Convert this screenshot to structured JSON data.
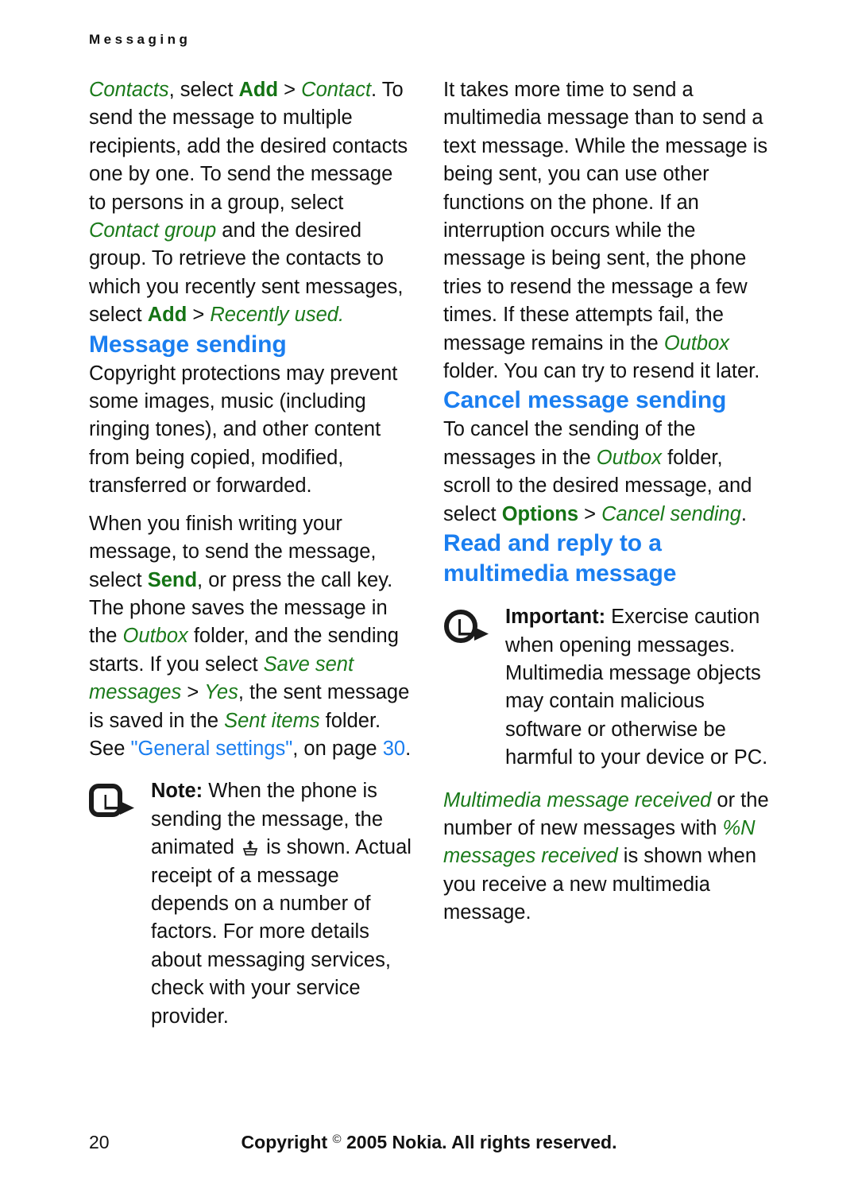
{
  "document": {
    "running_head": "Messaging",
    "page_number": "20",
    "footer_copyright_prefix": "Copyright",
    "footer_copyright_symbol": "©",
    "footer_copyright_suffix": "2005 Nokia. All rights reserved."
  },
  "colors": {
    "heading_blue": "#1a7ef0",
    "ui_green": "#1a7a1a",
    "link_blue": "#1a7ef0",
    "body_black": "#111111"
  },
  "left_column": {
    "para_continued": {
      "s1_ui": "Contacts",
      "s2": ", select ",
      "s3_ui_bold": "Add",
      "s4": " > ",
      "s5_ui": "Contact",
      "s6": ". To send the message to multiple recipients, add the desired contacts one by one. To send the message to persons in a group, select ",
      "s7_ui": "Contact group",
      "s8": " and the desired group. To retrieve the contacts to which you recently sent messages, select ",
      "s9_ui_bold": "Add",
      "s10": " > ",
      "s11_ui": "Recently used",
      "s12": "."
    },
    "heading_message_sending": "Message sending",
    "para_copyright": "Copyright protections may prevent some images, music (including ringing tones), and other content from being copied, modified, transferred or forwarded.",
    "para_send": {
      "s1": "When you finish writing your message, to send the message, select ",
      "s2_ui_bold": "Send",
      "s3": ", or press the call key. The phone saves the message in the ",
      "s4_ui": "Outbox",
      "s5": " folder, and the sending starts. If you select ",
      "s6_ui": "Save sent messages",
      "s7": " > ",
      "s8_ui": "Yes",
      "s9": ", the sent message is saved in the ",
      "s10_ui": "Sent items",
      "s11": " folder. See ",
      "s12_link": "\"General settings\"",
      "s13": ", on page ",
      "s14_link": "30",
      "s15": "."
    },
    "note": {
      "icon": "note-arrow-icon",
      "lead": "Note:",
      "text_before_glyph": " When the phone is sending the message, the animated ",
      "inline_glyph": "outbox-sending-icon",
      "text_after_glyph": " is shown. Actual receipt of a message depends on a number of factors. For more details about messaging services, check with your service provider."
    }
  },
  "right_column": {
    "para_timing": {
      "s1": "It takes more time to send a multimedia message than to send a text message. While the message is being sent, you can use other functions on the phone. If an interruption occurs while the message is being sent, the phone tries to resend the message a few times. If these attempts fail, the message remains in the ",
      "s2_ui": "Outbox",
      "s3": " folder. You can try to resend it later."
    },
    "heading_cancel": "Cancel message sending",
    "para_cancel": {
      "s1": "To cancel the sending of the messages in the ",
      "s2_ui": "Outbox",
      "s3": " folder, scroll to the desired message, and select ",
      "s4_ui_bold": "Options",
      "s5": " > ",
      "s6_ui": "Cancel sending",
      "s7": "."
    },
    "heading_read_reply": "Read and reply to a multimedia message",
    "important": {
      "icon": "important-arrow-icon",
      "lead": "Important:",
      "text": " Exercise caution when opening messages. Multimedia message objects may contain malicious software or otherwise be harmful to your device or PC."
    },
    "para_received": {
      "s1_ui": "Multimedia message received",
      "s2": " or the number of new messages with ",
      "s3_ui": "%N messages received",
      "s4": " is shown when you receive a new multimedia message."
    }
  }
}
